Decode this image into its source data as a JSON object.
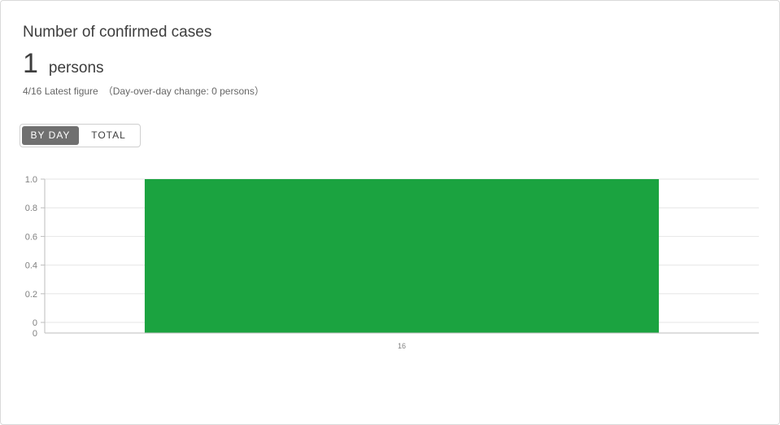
{
  "card": {
    "title": "Number of confirmed cases",
    "figure_value": "1",
    "figure_unit": "persons",
    "latest_label": "4/16 Latest figure",
    "change_label": "（Day-over-day change: 0 persons）"
  },
  "toggle": {
    "by_day_label": "BY DAY",
    "total_label": "TOTAL",
    "active": "by_day"
  },
  "colors": {
    "bar": "#1ba340",
    "grid": "#e6e6e6",
    "axis": "#bdbdbd",
    "tick_text": "#808080"
  },
  "chart_data": {
    "type": "bar",
    "categories": [
      "16"
    ],
    "values": [
      1
    ],
    "ylim": [
      0,
      1.0
    ],
    "yticks": [
      "1.0",
      "0.8",
      "0.6",
      "0.4",
      "0.2",
      "0"
    ],
    "secondary_ytick": "0",
    "title": "",
    "xlabel": "",
    "ylabel": "",
    "grid": true,
    "legend": "none"
  }
}
